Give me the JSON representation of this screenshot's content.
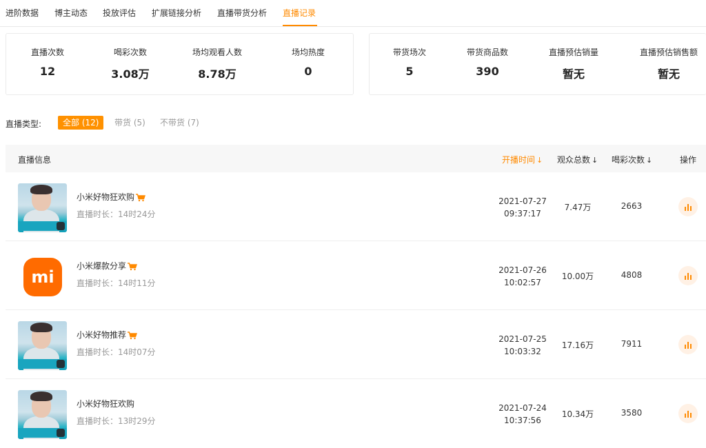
{
  "tabs": [
    "进阶数据",
    "博主动态",
    "投放评估",
    "扩展链接分析",
    "直播带货分析",
    "直播记录"
  ],
  "active_tab": "直播记录",
  "accent_color": "#ff8a00",
  "stats_left": [
    {
      "label": "直播次数",
      "value": "12"
    },
    {
      "label": "喝彩次数",
      "value": "3.08万"
    },
    {
      "label": "场均观看人数",
      "value": "8.78万"
    },
    {
      "label": "场均热度",
      "value": "0"
    }
  ],
  "stats_right": [
    {
      "label": "带货场次",
      "value": "5"
    },
    {
      "label": "带货商品数",
      "value": "390"
    },
    {
      "label": "直播预估销量",
      "value": "暂无"
    },
    {
      "label": "直播预估销售额",
      "value": "暂无"
    }
  ],
  "filter": {
    "label": "直播类型:",
    "options": [
      "全部 (12)",
      "带货 (5)",
      "不带货 (7)"
    ],
    "selected": "全部 (12)"
  },
  "table": {
    "headers": {
      "info": "直播信息",
      "start_time": "开播时间",
      "viewers": "观众总数",
      "cheers": "喝彩次数",
      "action": "操作"
    },
    "sort_arrow": "↓",
    "rows": [
      {
        "title": "小米好物狂欢购",
        "has_cart": true,
        "thumbnail": "photo",
        "duration": "直播时长：14时24分",
        "date": "2021-07-27",
        "time": "09:37:17",
        "viewers": "7.47万",
        "cheers": "2663"
      },
      {
        "title": "小米爆款分享",
        "has_cart": true,
        "thumbnail": "mi-logo",
        "duration": "直播时长：14时11分",
        "date": "2021-07-26",
        "time": "10:02:57",
        "viewers": "10.00万",
        "cheers": "4808"
      },
      {
        "title": "小米好物推荐",
        "has_cart": true,
        "thumbnail": "photo",
        "duration": "直播时长：14时07分",
        "date": "2021-07-25",
        "time": "10:03:32",
        "viewers": "17.16万",
        "cheers": "7911"
      },
      {
        "title": "小米好物狂欢购",
        "has_cart": false,
        "thumbnail": "photo",
        "duration": "直播时长：13时29分",
        "date": "2021-07-24",
        "time": "10:37:56",
        "viewers": "10.34万",
        "cheers": "3580"
      }
    ]
  },
  "icons": {
    "cart": "shopping-cart-icon",
    "chart": "bar-chart-icon",
    "logo": "mi"
  }
}
